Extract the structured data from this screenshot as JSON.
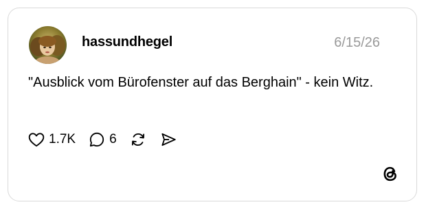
{
  "post": {
    "username": "hassundhegel",
    "date": "6/15/26",
    "text": "\"Ausblick vom Bürofenster auf das Berghain\" - kein Witz.",
    "likes": "1.7K",
    "replies": "6"
  },
  "icons": {
    "like": "heart-icon",
    "reply": "speech-bubble-icon",
    "repost": "repost-icon",
    "share": "send-icon",
    "brand": "threads-logo-icon"
  },
  "colors": {
    "border": "#d9d9d9",
    "date": "#999999",
    "text": "#000000"
  }
}
